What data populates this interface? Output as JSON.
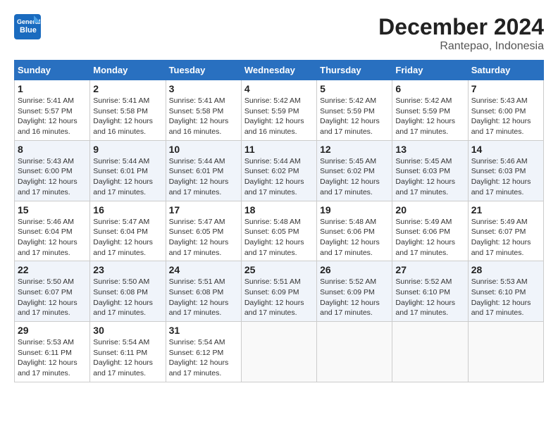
{
  "header": {
    "logo_line1": "General",
    "logo_line2": "Blue",
    "month": "December 2024",
    "location": "Rantepao, Indonesia"
  },
  "weekdays": [
    "Sunday",
    "Monday",
    "Tuesday",
    "Wednesday",
    "Thursday",
    "Friday",
    "Saturday"
  ],
  "weeks": [
    [
      {
        "day": "1",
        "info": "Sunrise: 5:41 AM\nSunset: 5:57 PM\nDaylight: 12 hours\nand 16 minutes."
      },
      {
        "day": "2",
        "info": "Sunrise: 5:41 AM\nSunset: 5:58 PM\nDaylight: 12 hours\nand 16 minutes."
      },
      {
        "day": "3",
        "info": "Sunrise: 5:41 AM\nSunset: 5:58 PM\nDaylight: 12 hours\nand 16 minutes."
      },
      {
        "day": "4",
        "info": "Sunrise: 5:42 AM\nSunset: 5:59 PM\nDaylight: 12 hours\nand 16 minutes."
      },
      {
        "day": "5",
        "info": "Sunrise: 5:42 AM\nSunset: 5:59 PM\nDaylight: 12 hours\nand 17 minutes."
      },
      {
        "day": "6",
        "info": "Sunrise: 5:42 AM\nSunset: 5:59 PM\nDaylight: 12 hours\nand 17 minutes."
      },
      {
        "day": "7",
        "info": "Sunrise: 5:43 AM\nSunset: 6:00 PM\nDaylight: 12 hours\nand 17 minutes."
      }
    ],
    [
      {
        "day": "8",
        "info": "Sunrise: 5:43 AM\nSunset: 6:00 PM\nDaylight: 12 hours\nand 17 minutes."
      },
      {
        "day": "9",
        "info": "Sunrise: 5:44 AM\nSunset: 6:01 PM\nDaylight: 12 hours\nand 17 minutes."
      },
      {
        "day": "10",
        "info": "Sunrise: 5:44 AM\nSunset: 6:01 PM\nDaylight: 12 hours\nand 17 minutes."
      },
      {
        "day": "11",
        "info": "Sunrise: 5:44 AM\nSunset: 6:02 PM\nDaylight: 12 hours\nand 17 minutes."
      },
      {
        "day": "12",
        "info": "Sunrise: 5:45 AM\nSunset: 6:02 PM\nDaylight: 12 hours\nand 17 minutes."
      },
      {
        "day": "13",
        "info": "Sunrise: 5:45 AM\nSunset: 6:03 PM\nDaylight: 12 hours\nand 17 minutes."
      },
      {
        "day": "14",
        "info": "Sunrise: 5:46 AM\nSunset: 6:03 PM\nDaylight: 12 hours\nand 17 minutes."
      }
    ],
    [
      {
        "day": "15",
        "info": "Sunrise: 5:46 AM\nSunset: 6:04 PM\nDaylight: 12 hours\nand 17 minutes."
      },
      {
        "day": "16",
        "info": "Sunrise: 5:47 AM\nSunset: 6:04 PM\nDaylight: 12 hours\nand 17 minutes."
      },
      {
        "day": "17",
        "info": "Sunrise: 5:47 AM\nSunset: 6:05 PM\nDaylight: 12 hours\nand 17 minutes."
      },
      {
        "day": "18",
        "info": "Sunrise: 5:48 AM\nSunset: 6:05 PM\nDaylight: 12 hours\nand 17 minutes."
      },
      {
        "day": "19",
        "info": "Sunrise: 5:48 AM\nSunset: 6:06 PM\nDaylight: 12 hours\nand 17 minutes."
      },
      {
        "day": "20",
        "info": "Sunrise: 5:49 AM\nSunset: 6:06 PM\nDaylight: 12 hours\nand 17 minutes."
      },
      {
        "day": "21",
        "info": "Sunrise: 5:49 AM\nSunset: 6:07 PM\nDaylight: 12 hours\nand 17 minutes."
      }
    ],
    [
      {
        "day": "22",
        "info": "Sunrise: 5:50 AM\nSunset: 6:07 PM\nDaylight: 12 hours\nand 17 minutes."
      },
      {
        "day": "23",
        "info": "Sunrise: 5:50 AM\nSunset: 6:08 PM\nDaylight: 12 hours\nand 17 minutes."
      },
      {
        "day": "24",
        "info": "Sunrise: 5:51 AM\nSunset: 6:08 PM\nDaylight: 12 hours\nand 17 minutes."
      },
      {
        "day": "25",
        "info": "Sunrise: 5:51 AM\nSunset: 6:09 PM\nDaylight: 12 hours\nand 17 minutes."
      },
      {
        "day": "26",
        "info": "Sunrise: 5:52 AM\nSunset: 6:09 PM\nDaylight: 12 hours\nand 17 minutes."
      },
      {
        "day": "27",
        "info": "Sunrise: 5:52 AM\nSunset: 6:10 PM\nDaylight: 12 hours\nand 17 minutes."
      },
      {
        "day": "28",
        "info": "Sunrise: 5:53 AM\nSunset: 6:10 PM\nDaylight: 12 hours\nand 17 minutes."
      }
    ],
    [
      {
        "day": "29",
        "info": "Sunrise: 5:53 AM\nSunset: 6:11 PM\nDaylight: 12 hours\nand 17 minutes."
      },
      {
        "day": "30",
        "info": "Sunrise: 5:54 AM\nSunset: 6:11 PM\nDaylight: 12 hours\nand 17 minutes."
      },
      {
        "day": "31",
        "info": "Sunrise: 5:54 AM\nSunset: 6:12 PM\nDaylight: 12 hours\nand 17 minutes."
      },
      {
        "day": "",
        "info": ""
      },
      {
        "day": "",
        "info": ""
      },
      {
        "day": "",
        "info": ""
      },
      {
        "day": "",
        "info": ""
      }
    ]
  ]
}
